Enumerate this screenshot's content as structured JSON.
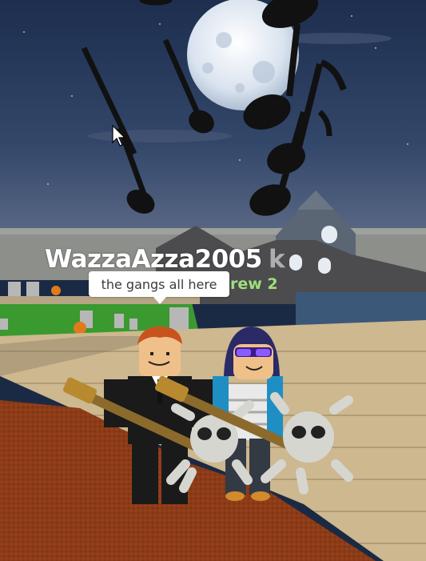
{
  "player": {
    "username": "WazzaAzza2005",
    "overlapping_name_fragment": "k"
  },
  "crew": {
    "label": "rew 2"
  },
  "chat": {
    "message": "the gangs all here"
  },
  "icons": {
    "cursor": "mouse-pointer-icon"
  },
  "colors": {
    "sky": "#1f3252",
    "moon": "#e8eef6",
    "nameplate_text": "#ffffff",
    "crew_text": "#9fe07a",
    "floor_wood": "#c9b48a",
    "carpet": "#8a3a17"
  }
}
